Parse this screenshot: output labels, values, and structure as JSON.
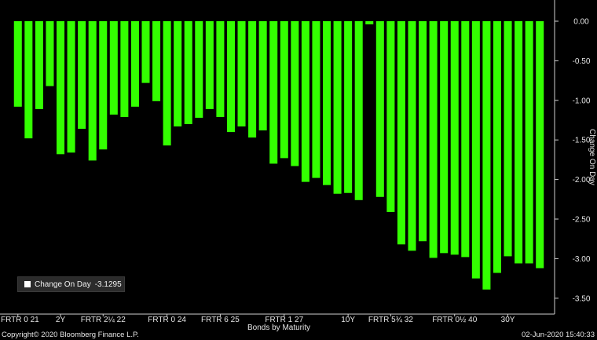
{
  "chart_data": {
    "type": "bar",
    "ylabel": "Change On Day",
    "xlabel": "Bonds by Maturity",
    "ylim": [
      -3.7,
      0.2
    ],
    "yticks": [
      "0.00",
      "-0.50",
      "-1.00",
      "-1.50",
      "-2.00",
      "-2.50",
      "-3.00",
      "-3.50"
    ],
    "ytick_values": [
      0,
      -0.5,
      -1.0,
      -1.5,
      -2.0,
      -2.5,
      -3.0,
      -3.5
    ],
    "x_tick_labels": [
      {
        "index": 0,
        "label": "FRTR 0 21"
      },
      {
        "index": 4,
        "label": "2Y"
      },
      {
        "index": 8,
        "label": "FRTR 2¼ 22"
      },
      {
        "index": 14,
        "label": "FRTR 0 24"
      },
      {
        "index": 19,
        "label": "FRTR 6 25"
      },
      {
        "index": 25,
        "label": "FRTR 1 27"
      },
      {
        "index": 31,
        "label": "10Y"
      },
      {
        "index": 35,
        "label": "FRTR 5¾ 32"
      },
      {
        "index": 41,
        "label": "FRTR 0½ 40"
      },
      {
        "index": 46,
        "label": "30Y"
      }
    ],
    "values": [
      -1.08,
      -1.48,
      -1.11,
      -0.82,
      -1.68,
      -1.66,
      -1.36,
      -1.76,
      -1.62,
      -1.18,
      -1.21,
      -1.08,
      -0.78,
      -1.01,
      -1.57,
      -1.33,
      -1.3,
      -1.22,
      -1.11,
      -1.21,
      -1.4,
      -1.33,
      -1.47,
      -1.38,
      -1.8,
      -1.73,
      -1.83,
      -2.03,
      -1.98,
      -2.07,
      -2.18,
      -2.17,
      -2.26,
      -0.04,
      -2.22,
      -2.41,
      -2.82,
      -2.9,
      -2.78,
      -2.99,
      -2.93,
      -2.95,
      -2.98,
      -3.25,
      -3.39,
      -3.18,
      -2.97,
      -3.06,
      -3.06,
      -3.12
    ],
    "bar_color": "#33ff00",
    "highlight_color": "#ffffff",
    "legend": {
      "label": "Change On Day",
      "value": "-3.1295",
      "placement": "bottom-left"
    }
  },
  "footer": {
    "copyright": "Copyright© 2020 Bloomberg Finance L.P.",
    "timestamp": "02-Jun-2020 15:40:33"
  }
}
